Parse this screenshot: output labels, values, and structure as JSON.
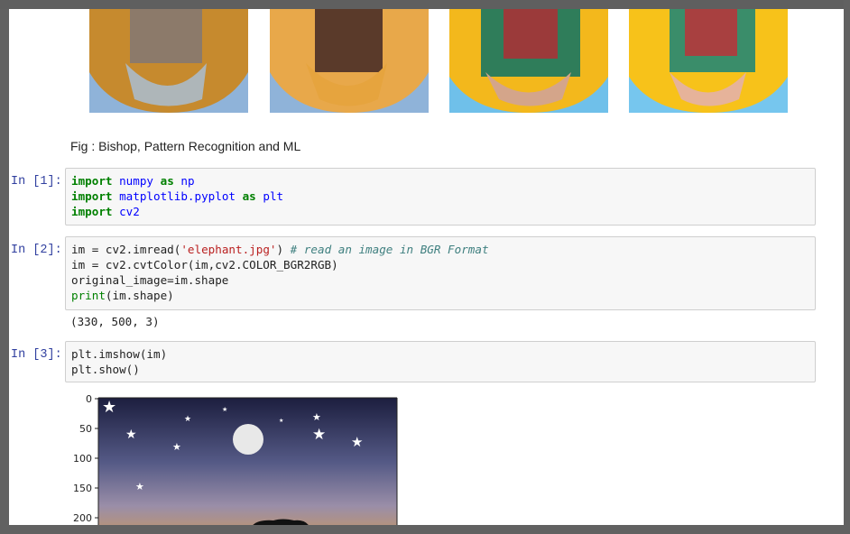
{
  "figure_strip": {
    "caption": "Fig : Bishop, Pattern Recognition and ML"
  },
  "cells": [
    {
      "prompt": "In [1]:",
      "lines": [
        "import numpy as np",
        "import matplotlib.pyplot as plt",
        "import cv2"
      ]
    },
    {
      "prompt": "In [2]:",
      "lines": [
        "im = cv2.imread('elephant.jpg') # read an image in BGR Format",
        "im = cv2.cvtColor(im,cv2.COLOR_BGR2RGB)",
        "original_image=im.shape",
        "print(im.shape)"
      ],
      "output": "(330, 500, 3)"
    },
    {
      "prompt": "In [3]:",
      "lines": [
        "plt.imshow(im)",
        "plt.show()"
      ]
    }
  ],
  "plot": {
    "y_ticks": [
      "0",
      "50",
      "100",
      "150",
      "200"
    ]
  },
  "colors": {
    "prompt": "#303f9f",
    "keyword": "#008000",
    "string": "#ba2121",
    "comment": "#408080",
    "module": "#0000ff"
  }
}
